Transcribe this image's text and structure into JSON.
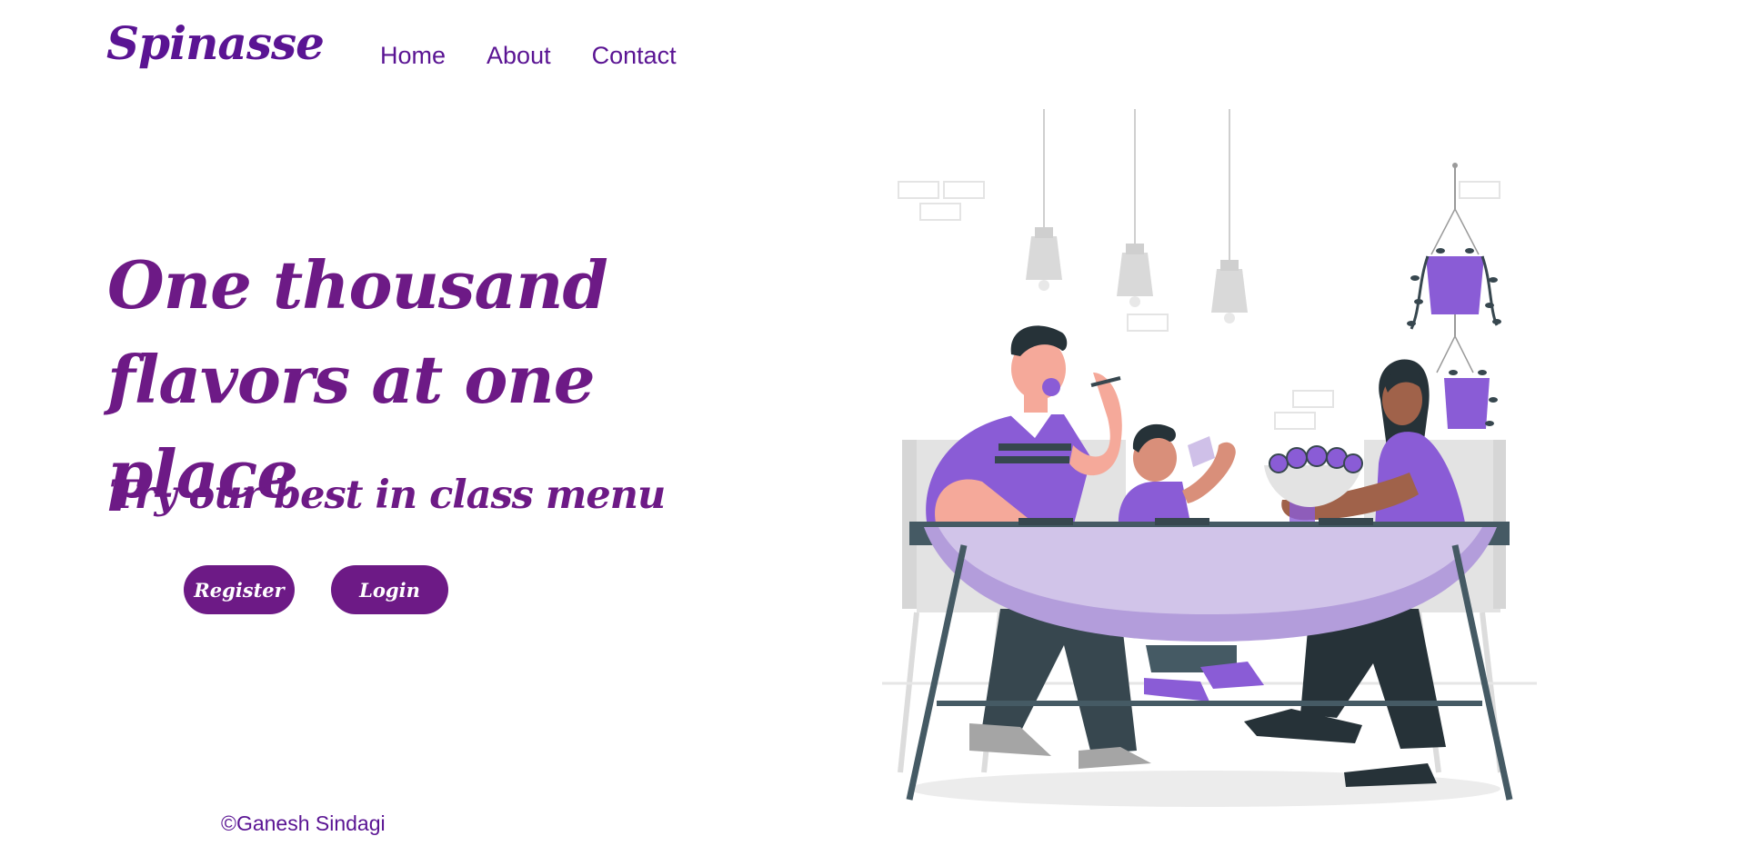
{
  "header": {
    "brand": "Spinasse",
    "nav": [
      {
        "label": "Home"
      },
      {
        "label": "About"
      },
      {
        "label": "Contact"
      }
    ]
  },
  "hero": {
    "title": "One thousand flavors at one place",
    "subtitle": "Try our best in class menu",
    "register_label": "Register",
    "login_label": "Login"
  },
  "footer": {
    "credit": "©Ganesh Sindagi"
  },
  "colors": {
    "brand": "#5a1493",
    "accent": "#6d1a86",
    "illustration_purple": "#8a5cd6",
    "illustration_lavender": "#cfc0e8"
  },
  "illustration": {
    "subject": "family-dining-illustration"
  }
}
